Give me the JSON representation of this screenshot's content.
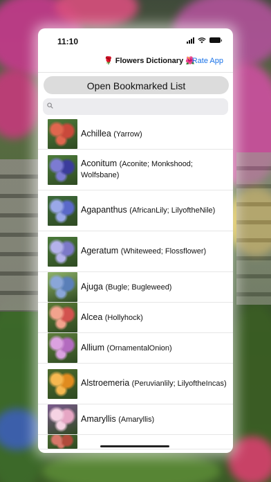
{
  "status_bar": {
    "time": "11:10"
  },
  "nav": {
    "title": "🌹 Flowers Dictionary 🌺",
    "rate_app": "Rate App"
  },
  "bookmark_button": "Open Bookmarked List",
  "search": {
    "placeholder": "",
    "value": ""
  },
  "flowers": [
    {
      "name": "Achillea",
      "common": "(Yarrow)",
      "colors": [
        "#c9493b",
        "#e0664e",
        "#4f7a3a"
      ]
    },
    {
      "name": "Aconitum",
      "common": "(Aconite; Monkshood; Wolfsbane)",
      "colors": [
        "#3b3c9b",
        "#7c7bd2",
        "#4d7c3b"
      ]
    },
    {
      "name": "Agapanthus",
      "common": "(AfricanLily; LilyoftheNile)",
      "colors": [
        "#5a69c9",
        "#9aa8e8",
        "#3d6a3a"
      ]
    },
    {
      "name": "Ageratum",
      "common": "(Whiteweed; Flossflower)",
      "colors": [
        "#7c79c8",
        "#b4b2ea",
        "#4a7a39"
      ]
    },
    {
      "name": "Ajuga",
      "common": "(Bugle; Bugleweed)",
      "colors": [
        "#5a7fb8",
        "#8aa6d8",
        "#8fb36a"
      ]
    },
    {
      "name": "Alcea",
      "common": "(Hollyhock)",
      "colors": [
        "#d2524e",
        "#f2a38d",
        "#5a7a35"
      ]
    },
    {
      "name": "Allium",
      "common": "(OrnamentalOnion)",
      "colors": [
        "#b36bbf",
        "#dba2e0",
        "#5d7e3b"
      ]
    },
    {
      "name": "Alstroemeria",
      "common": "(Peruvianlily; LilyoftheIncas)",
      "colors": [
        "#e08b1f",
        "#f6b850",
        "#4c6a2c"
      ]
    },
    {
      "name": "Amaryllis",
      "common": "(Amaryllis)",
      "colors": [
        "#e6a6c4",
        "#f5d3e3",
        "#7a5a8c"
      ]
    },
    {
      "name": "",
      "common": "",
      "colors": [
        "#b04a3a",
        "#d7776a",
        "#4a6a30"
      ]
    }
  ]
}
